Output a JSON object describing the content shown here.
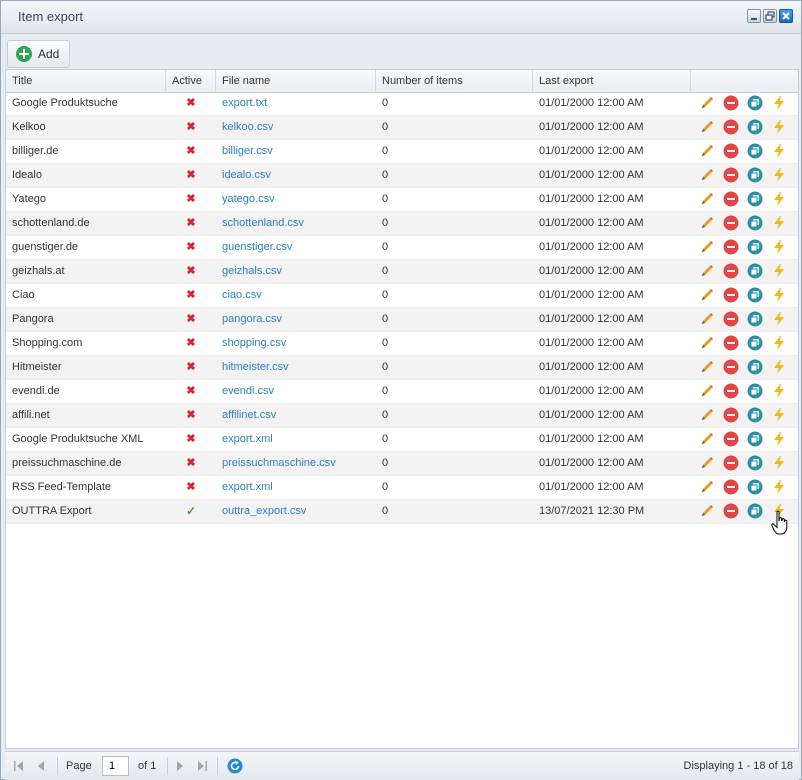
{
  "window": {
    "title": "Item export"
  },
  "toolbar": {
    "add_label": "Add"
  },
  "columns": [
    "Title",
    "Active",
    "File name",
    "Number of items",
    "Last export"
  ],
  "rows": [
    {
      "title": "Google Produktsuche",
      "active": false,
      "file": "export.txt",
      "count": "0",
      "last": "01/01/2000 12:00 AM"
    },
    {
      "title": "Kelkoo",
      "active": false,
      "file": "kelkoo.csv",
      "count": "0",
      "last": "01/01/2000 12:00 AM"
    },
    {
      "title": "billiger.de",
      "active": false,
      "file": "billiger.csv",
      "count": "0",
      "last": "01/01/2000 12:00 AM"
    },
    {
      "title": "Idealo",
      "active": false,
      "file": "idealo.csv",
      "count": "0",
      "last": "01/01/2000 12:00 AM"
    },
    {
      "title": "Yatego",
      "active": false,
      "file": "yatego.csv",
      "count": "0",
      "last": "01/01/2000 12:00 AM"
    },
    {
      "title": "schottenland.de",
      "active": false,
      "file": "schottenland.csv",
      "count": "0",
      "last": "01/01/2000 12:00 AM"
    },
    {
      "title": "guenstiger.de",
      "active": false,
      "file": "guenstiger.csv",
      "count": "0",
      "last": "01/01/2000 12:00 AM"
    },
    {
      "title": "geizhals.at",
      "active": false,
      "file": "geizhals.csv",
      "count": "0",
      "last": "01/01/2000 12:00 AM"
    },
    {
      "title": "Ciao",
      "active": false,
      "file": "ciao.csv",
      "count": "0",
      "last": "01/01/2000 12:00 AM"
    },
    {
      "title": "Pangora",
      "active": false,
      "file": "pangora.csv",
      "count": "0",
      "last": "01/01/2000 12:00 AM"
    },
    {
      "title": "Shopping.com",
      "active": false,
      "file": "shopping.csv",
      "count": "0",
      "last": "01/01/2000 12:00 AM"
    },
    {
      "title": "Hitmeister",
      "active": false,
      "file": "hitmeister.csv",
      "count": "0",
      "last": "01/01/2000 12:00 AM"
    },
    {
      "title": "evendi.de",
      "active": false,
      "file": "evendi.csv",
      "count": "0",
      "last": "01/01/2000 12:00 AM"
    },
    {
      "title": "affili.net",
      "active": false,
      "file": "affilinet.csv",
      "count": "0",
      "last": "01/01/2000 12:00 AM"
    },
    {
      "title": "Google Produktsuche XML",
      "active": false,
      "file": "export.xml",
      "count": "0",
      "last": "01/01/2000 12:00 AM"
    },
    {
      "title": "preissuchmaschine.de",
      "active": false,
      "file": "preissuchmaschine.csv",
      "count": "0",
      "last": "01/01/2000 12:00 AM"
    },
    {
      "title": "RSS Feed-Template",
      "active": false,
      "file": "export.xml",
      "count": "0",
      "last": "01/01/2000 12:00 AM"
    },
    {
      "title": "OUTTRA Export",
      "active": true,
      "file": "outtra_export.csv",
      "count": "0",
      "last": "13/07/2021 12:30 PM"
    }
  ],
  "row_actions": [
    "pencil-icon",
    "delete-icon",
    "duplicate-icon",
    "lightning-icon"
  ],
  "pager": {
    "page_label": "Page",
    "page_value": "1",
    "of_label": "of 1",
    "displaying": "Displaying 1 - 18 of 18"
  },
  "colors": {
    "link": "#2d7fc4",
    "inactive": "#dd2222",
    "active": "#3aa33a",
    "edit": "#e8961c",
    "delete": "#e04646",
    "duplicate": "#2f8fa5",
    "run": "#f2b81c"
  }
}
